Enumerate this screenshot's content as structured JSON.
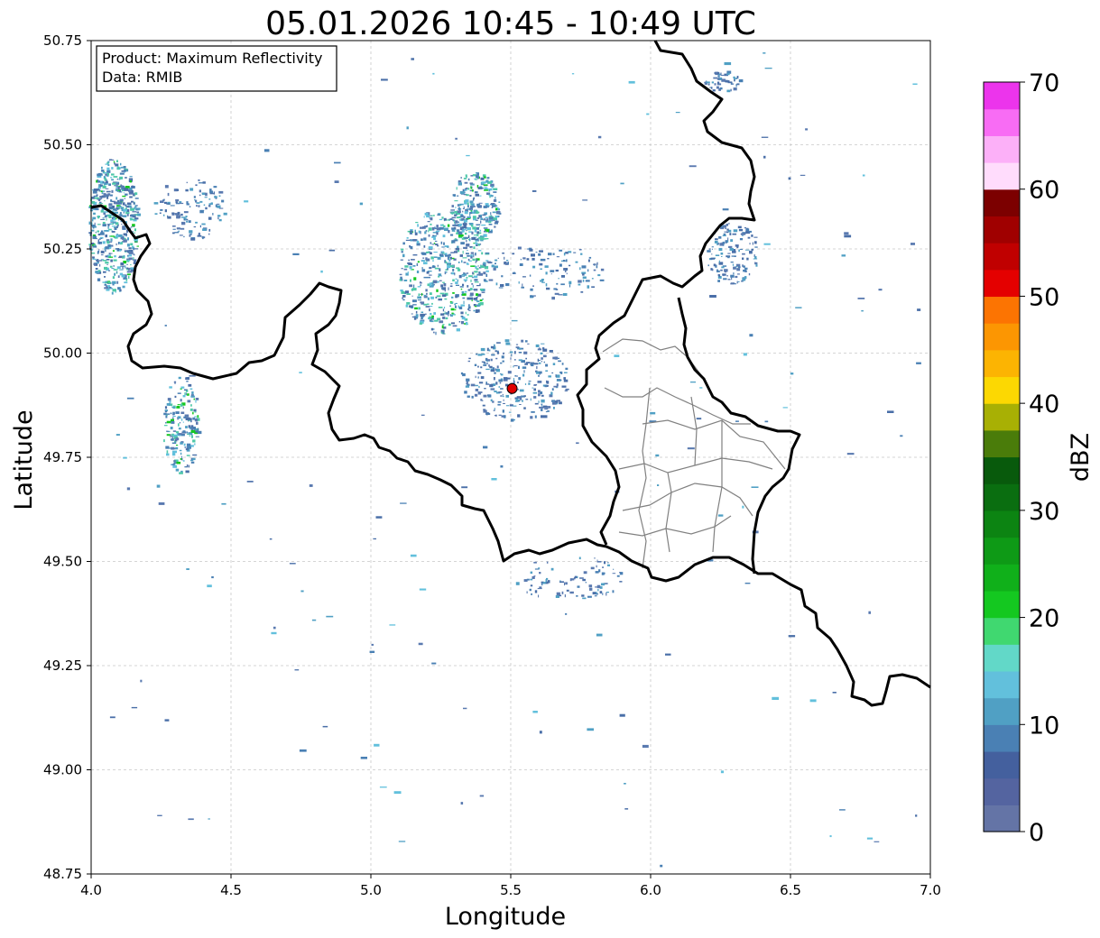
{
  "title": "05.01.2026 10:45 - 10:49 UTC",
  "info_box": {
    "line1": "Product: Maximum Reflectivity",
    "line2": "Data: RMIB"
  },
  "axes": {
    "xlabel": "Longitude",
    "ylabel": "Latitude",
    "xlim": [
      4.0,
      7.0
    ],
    "ylim": [
      48.75,
      50.75
    ],
    "xticks": [
      "4.0",
      "4.5",
      "5.0",
      "5.5",
      "6.0",
      "6.5",
      "7.0"
    ],
    "yticks": [
      "48.75",
      "49.00",
      "49.25",
      "49.50",
      "49.75",
      "50.00",
      "50.25",
      "50.50",
      "50.75"
    ],
    "grid": true
  },
  "colorbar": {
    "label": "dBZ",
    "min": 0,
    "max": 70,
    "ticks": [
      "0",
      "10",
      "20",
      "30",
      "40",
      "50",
      "60",
      "70"
    ],
    "colors": [
      "#6474a6",
      "#5464a0",
      "#44609e",
      "#4a80b4",
      "#50a0c4",
      "#62c0dc",
      "#62d8c8",
      "#40d870",
      "#14c820",
      "#10b01a",
      "#0e9a16",
      "#0c8412",
      "#0a6e10",
      "#085a0c",
      "#4a7c0a",
      "#a8b004",
      "#fcd802",
      "#fcb402",
      "#fc9602",
      "#fc7402",
      "#e40000",
      "#c00000",
      "#a00000",
      "#7c0000",
      "#ffdcfc",
      "#fcb0f8",
      "#f86cf4",
      "#ec34ec"
    ]
  },
  "radar_site": {
    "lon": 5.505,
    "lat": 49.915,
    "color": "#ff0000"
  },
  "colors": {
    "border": "#000000",
    "province": "#808080",
    "grid": "#c8c8c8"
  }
}
